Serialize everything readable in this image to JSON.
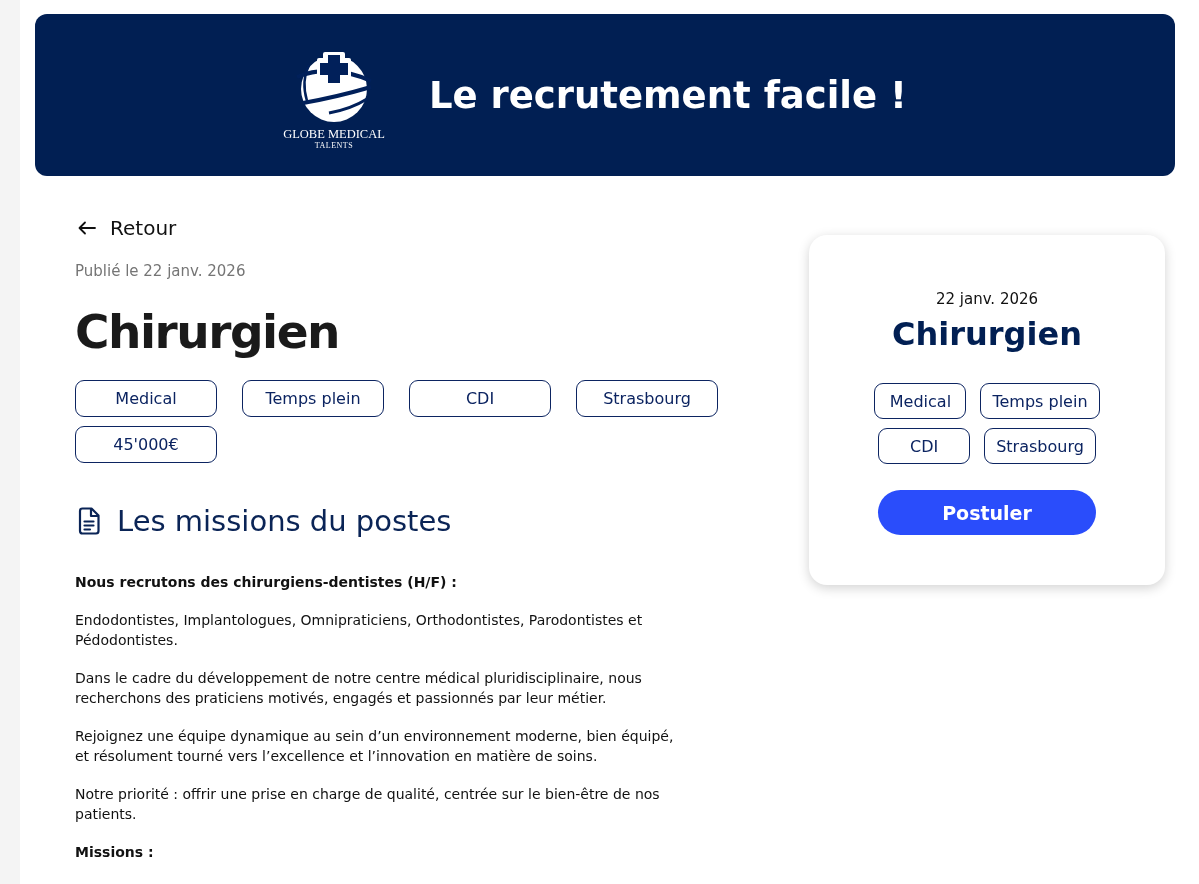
{
  "header": {
    "logo": {
      "name": "GLOBE MEDICAL",
      "subtitle": "TALENTS"
    },
    "tagline": "Le recrutement facile !"
  },
  "job": {
    "back_link": "Retour",
    "published": "Publié le 22 janv. 2026",
    "title": "Chirurgien",
    "tags": [
      "Medical",
      "Temps plein",
      "CDI",
      "Strasbourg",
      "45'000€"
    ]
  },
  "missions": {
    "heading": "Les missions du postes",
    "paragraphs": [
      {
        "kind": "bold",
        "text": "Nous recrutons des chirurgiens-dentistes (H/F) :"
      },
      {
        "kind": "text",
        "text": "Endodontistes, Implantologues, Omnipraticiens, Orthodontistes, Parodontistes et Pédodontistes."
      },
      {
        "kind": "text",
        "text": "Dans le cadre du développement de notre centre médical pluridisciplinaire, nous recherchons des praticiens motivés, engagés et passionnés par leur métier."
      },
      {
        "kind": "text",
        "text": "Rejoignez une équipe dynamique au sein d’un environnement moderne, bien équipé, et résolument tourné vers l’excellence et l’innovation en matière de soins."
      },
      {
        "kind": "text",
        "text": "Notre priorité : offrir une prise en charge de qualité, centrée sur le bien-être de nos patients."
      },
      {
        "kind": "bold",
        "text": "Missions :"
      }
    ]
  },
  "summary_card": {
    "date": "22 janv. 2026",
    "title": "Chirurgien",
    "tags": [
      "Medical",
      "Temps plein",
      "CDI",
      "Strasbourg"
    ],
    "apply_button": "Postuler"
  }
}
